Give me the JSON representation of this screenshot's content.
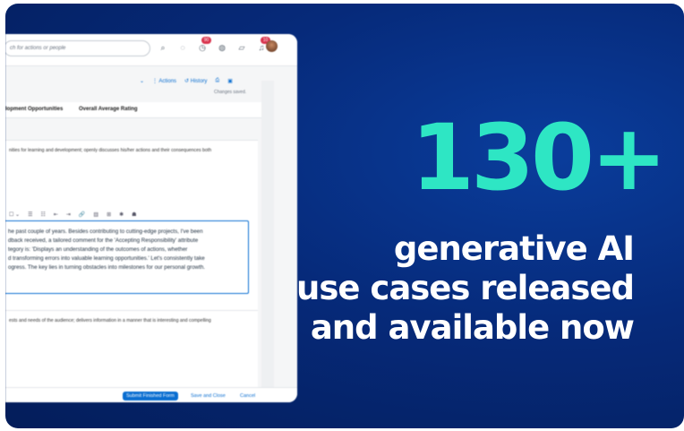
{
  "headline": {
    "stat": "130+",
    "lines": [
      "generative AI",
      "use cases released",
      "and available now"
    ]
  },
  "colors": {
    "background": "#062a7a",
    "accent": "#2ee6c4",
    "text": "#ffffff",
    "link": "#0a6ed1"
  },
  "screenshot": {
    "search_placeholder": "ch for actions or people",
    "icons": [
      {
        "name": "search-icon",
        "glyph": "⌕"
      },
      {
        "name": "lightbulb-icon",
        "glyph": "◌"
      },
      {
        "name": "clock-icon",
        "glyph": "◷",
        "badge": "90"
      },
      {
        "name": "globe-icon",
        "glyph": "◍"
      },
      {
        "name": "chat-icon",
        "glyph": "▱"
      },
      {
        "name": "bell-icon",
        "glyph": "♫",
        "badge": "10"
      }
    ],
    "toolbar": {
      "chevron": "⌄",
      "actions": "⋮ Actions",
      "history": "↺ History",
      "print": "⎙",
      "save": "▣",
      "status": "Changes saved."
    },
    "tabs": [
      "lopment Opportunities",
      "Overall Average Rating"
    ],
    "section1_desc": "nities for learning and development; openly discusses his/her actions and their consequences both",
    "rte_tools": [
      "☐ ⌄",
      "☰",
      "☷",
      "⇤",
      "⇥",
      "🔗",
      "▤",
      "⊞",
      "✱",
      "☗"
    ],
    "editor_lines": [
      "he past couple of years. Besides contributing to cutting-edge projects, I've been",
      "dback received, a tailored comment for the 'Accepting Responsibility' attribute",
      "tegory is: 'Displays an understanding of the outcomes of actions, whether",
      "d transforming errors into valuable learning opportunities.' Let's consistently take",
      "ogress. The key lies in turning obstacles into milestones for our personal growth."
    ],
    "section2_desc": "ests and needs of the audience; delivers information in a manner that is interesting and compelling",
    "footer": {
      "submit": "Submit Finished Form",
      "save_close": "Save and Close",
      "cancel": "Cancel"
    }
  }
}
